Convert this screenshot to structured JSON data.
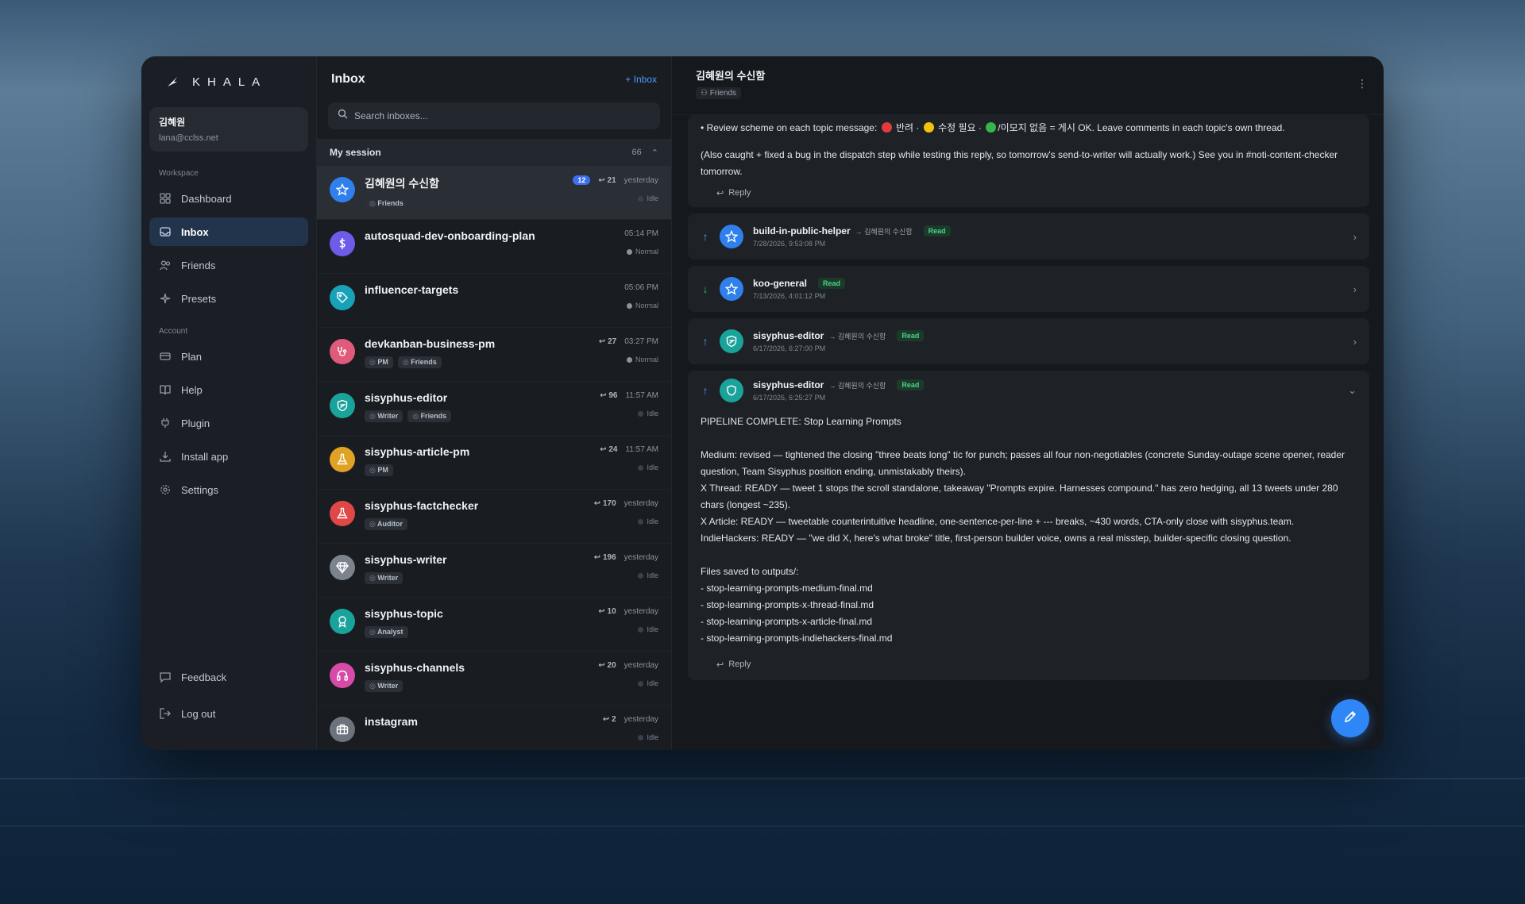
{
  "app": {
    "brand": "KHALA"
  },
  "user": {
    "name": "김혜원",
    "email": "lana@cclss.net"
  },
  "sidebar": {
    "workspace_label": "Workspace",
    "workspace_items": [
      {
        "label": "Dashboard",
        "icon": "grid-icon"
      },
      {
        "label": "Inbox",
        "icon": "inbox-icon",
        "active": true
      },
      {
        "label": "Friends",
        "icon": "people-icon"
      },
      {
        "label": "Presets",
        "icon": "sparkle-icon"
      }
    ],
    "account_label": "Account",
    "account_items": [
      {
        "label": "Plan",
        "icon": "card-icon"
      },
      {
        "label": "Help",
        "icon": "book-icon"
      },
      {
        "label": "Plugin",
        "icon": "plug-icon"
      },
      {
        "label": "Install app",
        "icon": "download-icon"
      },
      {
        "label": "Settings",
        "icon": "gear-icon"
      }
    ],
    "bottom_items": [
      {
        "label": "Feedback",
        "icon": "chat-icon"
      },
      {
        "label": "Log out",
        "icon": "logout-icon"
      }
    ]
  },
  "inbox_list": {
    "title": "Inbox",
    "add_label": "+ Inbox",
    "search_placeholder": "Search inboxes...",
    "session_label": "My session",
    "session_count": "66",
    "rows": [
      {
        "name": "김혜원의 수신함",
        "tags": [
          "Friends"
        ],
        "badge": "12",
        "replies": "↩ 21",
        "time": "yesterday",
        "status": "Idle",
        "avatar_color": "#2f80ed",
        "avatar_icon": "star-icon"
      },
      {
        "name": "autosquad-dev-onboarding-plan",
        "tags": [],
        "badge": "",
        "replies": "",
        "time": "05:14 PM",
        "status": "Normal",
        "avatar_color": "#6c5ce7",
        "avatar_icon": "dollar-icon"
      },
      {
        "name": "influencer-targets",
        "tags": [],
        "badge": "",
        "replies": "",
        "time": "05:06 PM",
        "status": "Normal",
        "avatar_color": "#17a2b8",
        "avatar_icon": "tag-icon"
      },
      {
        "name": "devkanban-business-pm",
        "tags": [
          "PM",
          "Friends"
        ],
        "badge": "",
        "replies": "↩ 27",
        "time": "03:27 PM",
        "status": "Normal",
        "avatar_color": "#e05a7a",
        "avatar_icon": "stethoscope-icon"
      },
      {
        "name": "sisyphus-editor",
        "tags": [
          "Writer",
          "Friends"
        ],
        "badge": "",
        "replies": "↩ 96",
        "time": "11:57 AM",
        "status": "Idle",
        "avatar_color": "#1aa39a",
        "avatar_icon": "shield-icon"
      },
      {
        "name": "sisyphus-article-pm",
        "tags": [
          "PM"
        ],
        "badge": "",
        "replies": "↩ 24",
        "time": "11:57 AM",
        "status": "Idle",
        "avatar_color": "#e0a224",
        "avatar_icon": "flask-icon"
      },
      {
        "name": "sisyphus-factchecker",
        "tags": [
          "Auditor"
        ],
        "badge": "",
        "replies": "↩ 170",
        "time": "yesterday",
        "status": "Idle",
        "avatar_color": "#e04848",
        "avatar_icon": "flask-icon"
      },
      {
        "name": "sisyphus-writer",
        "tags": [
          "Writer"
        ],
        "badge": "",
        "replies": "↩ 196",
        "time": "yesterday",
        "status": "Idle",
        "avatar_color": "#7b838d",
        "avatar_icon": "diamond-icon"
      },
      {
        "name": "sisyphus-topic",
        "tags": [
          "Analyst"
        ],
        "badge": "",
        "replies": "↩ 10",
        "time": "yesterday",
        "status": "Idle",
        "avatar_color": "#1aa39a",
        "avatar_icon": "award-icon"
      },
      {
        "name": "sisyphus-channels",
        "tags": [
          "Writer"
        ],
        "badge": "",
        "replies": "↩ 20",
        "time": "yesterday",
        "status": "Idle",
        "avatar_color": "#d84aa8",
        "avatar_icon": "headphones-icon"
      },
      {
        "name": "instagram",
        "tags": [],
        "badge": "",
        "replies": "↩ 2",
        "time": "yesterday",
        "status": "Idle",
        "avatar_color": "#6c737c",
        "avatar_icon": "briefcase-icon"
      }
    ]
  },
  "thread": {
    "title": "김혜원의 수신함",
    "subtitle": "Friends",
    "top_message": {
      "line1_a": "• Review scheme on each topic message: ",
      "line1_b": " 반려 · ",
      "line1_c": " 수정 필요 · ",
      "line1_d": "/이모지 없음 = 게시 OK. Leave comments in each topic's own thread.",
      "line2": "(Also caught + fixed a bug in the dispatch step while testing this reply, so tomorrow's send-to-writer will actually work.) See you in #noti-content-checker tomorrow.",
      "reply": "Reply"
    },
    "messages": [
      {
        "direction": "up",
        "name": "build-in-public-helper",
        "to": "→ 김혜원의 수신함",
        "status": "Read",
        "date": "7/28/2026, 9:53:08 PM",
        "avatar_color": "#2f80ed",
        "avatar_icon": "star-icon"
      },
      {
        "direction": "down",
        "name": "koo-general",
        "to": "",
        "status": "Read",
        "date": "7/13/2026, 4:01:12 PM",
        "avatar_color": "#2f80ed",
        "avatar_icon": "star-icon"
      },
      {
        "direction": "up",
        "name": "sisyphus-editor",
        "to": "→ 김혜원의 수신함",
        "status": "Read",
        "date": "6/17/2026, 6:27:00 PM",
        "avatar_color": "#1aa39a",
        "avatar_icon": "shield-icon"
      }
    ],
    "expanded": {
      "direction": "up",
      "name": "sisyphus-editor",
      "to": "→ 김혜원의 수신함",
      "status": "Read",
      "date": "6/17/2026, 6:25:27 PM",
      "avatar_color": "#1aa39a",
      "heading": "PIPELINE COMPLETE: Stop Learning Prompts",
      "body": [
        "Medium: revised — tightened the closing \"three beats long\" tic for punch; passes all four non-negotiables (concrete Sunday-outage scene opener, reader question, Team Sisyphus position ending, unmistakably theirs).",
        "X Thread: READY — tweet 1 stops the scroll standalone, takeaway \"Prompts expire. Harnesses compound.\" has zero hedging, all 13 tweets under 280 chars (longest ~235).",
        "X Article: READY — tweetable counterintuitive headline, one-sentence-per-line + --- breaks, ~430 words, CTA-only close with sisyphus.team.",
        "IndieHackers: READY — \"we did X, here's what broke\" title, first-person builder voice, owns a real misstep, builder-specific closing question."
      ],
      "files_heading": "Files saved to outputs/:",
      "files": [
        "- stop-learning-prompts-medium-final.md",
        "- stop-learning-prompts-x-thread-final.md",
        "- stop-learning-prompts-x-article-final.md",
        "- stop-learning-prompts-indiehackers-final.md"
      ],
      "reply": "Reply"
    }
  }
}
